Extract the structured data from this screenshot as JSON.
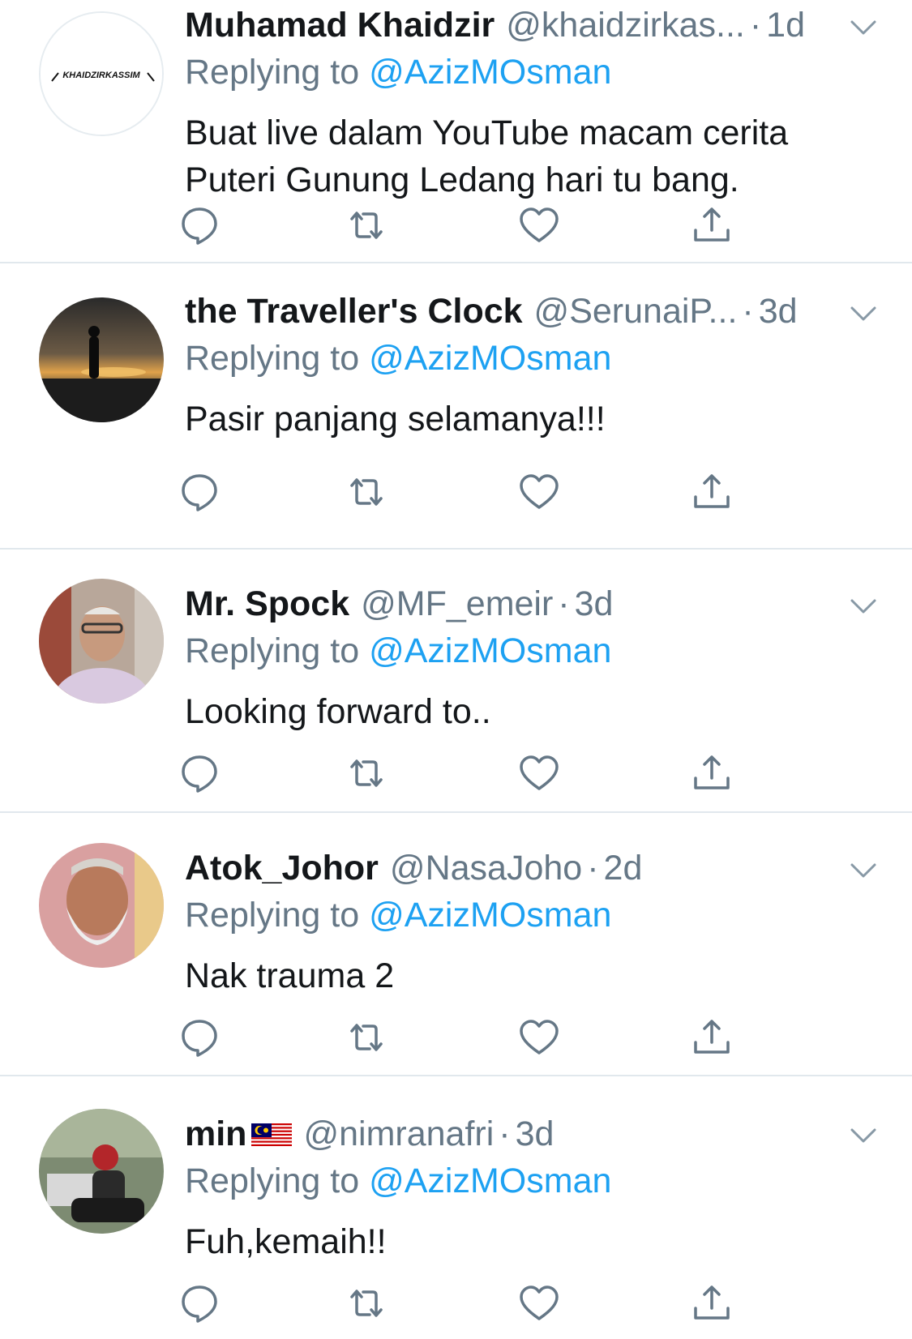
{
  "colors": {
    "name": "#14171a",
    "meta": "#657786",
    "link": "#1da1f2",
    "divider": "#e1e8ed"
  },
  "icons": {
    "reply": "comment-icon",
    "retweet": "retweet-icon",
    "like": "heart-icon",
    "share": "share-icon",
    "more": "chevron-down-icon"
  },
  "replies": [
    {
      "name": "Muhamad Khaidzir",
      "handle": "@khaidzirkas...",
      "time": "1d",
      "replying_label": "Replying to",
      "replying_to": "@AzizMOsman",
      "text": "Buat live dalam YouTube macam cerita Puteri Gunung Ledang hari tu bang.",
      "avatar_logo_text": "KHAIDZIRKASSIM"
    },
    {
      "name": "the Traveller's Clock",
      "handle": "@SerunaiP...",
      "time": "3d",
      "replying_label": "Replying to",
      "replying_to": "@AzizMOsman",
      "text": "Pasir panjang selamanya!!!"
    },
    {
      "name": "Mr. Spock",
      "handle": "@MF_emeir",
      "time": "3d",
      "replying_label": "Replying to",
      "replying_to": "@AzizMOsman",
      "text": "Looking forward to.."
    },
    {
      "name": "Atok_Johor",
      "handle": "@NasaJoho",
      "time": "2d",
      "replying_label": "Replying to",
      "replying_to": "@AzizMOsman",
      "text": "Nak trauma 2"
    },
    {
      "name": "min",
      "handle": "@nimranafri",
      "time": "3d",
      "replying_label": "Replying to",
      "replying_to": "@AzizMOsman",
      "text": "Fuh,kemaih!!"
    }
  ]
}
